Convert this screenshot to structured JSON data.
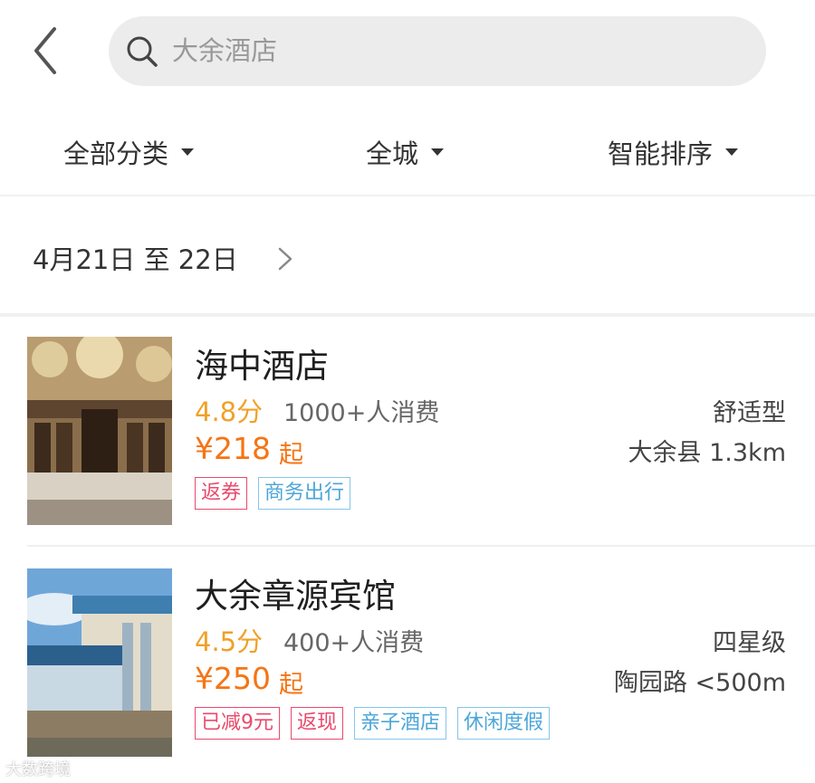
{
  "search": {
    "placeholder": "大余酒店"
  },
  "filters": [
    {
      "label": "全部分类"
    },
    {
      "label": "全城"
    },
    {
      "label": "智能排序"
    }
  ],
  "date_range": {
    "text": "4月21日 至 22日"
  },
  "hotels": [
    {
      "name": "海中酒店",
      "score": "4.8分",
      "consumption": "1000+人消费",
      "price": "¥218",
      "price_suffix": "起",
      "type": "舒适型",
      "location": "大余县 1.3km",
      "tags": [
        {
          "label": "返券",
          "color": "red"
        },
        {
          "label": "商务出行",
          "color": "blue"
        }
      ]
    },
    {
      "name": "大余章源宾馆",
      "score": "4.5分",
      "consumption": "400+人消费",
      "price": "¥250",
      "price_suffix": "起",
      "type": "四星级",
      "location": "陶园路 <500m",
      "tags": [
        {
          "label": "已减9元",
          "color": "red"
        },
        {
          "label": "返现",
          "color": "red"
        },
        {
          "label": "亲子酒店",
          "color": "blue"
        },
        {
          "label": "休闲度假",
          "color": "blue"
        }
      ]
    }
  ],
  "watermark": {
    "text": "大数跨境"
  },
  "colors": {
    "score": "#f0a128",
    "price": "#f57515",
    "tag_red": "#ea4a6c",
    "tag_blue": "#4ca6d8"
  }
}
